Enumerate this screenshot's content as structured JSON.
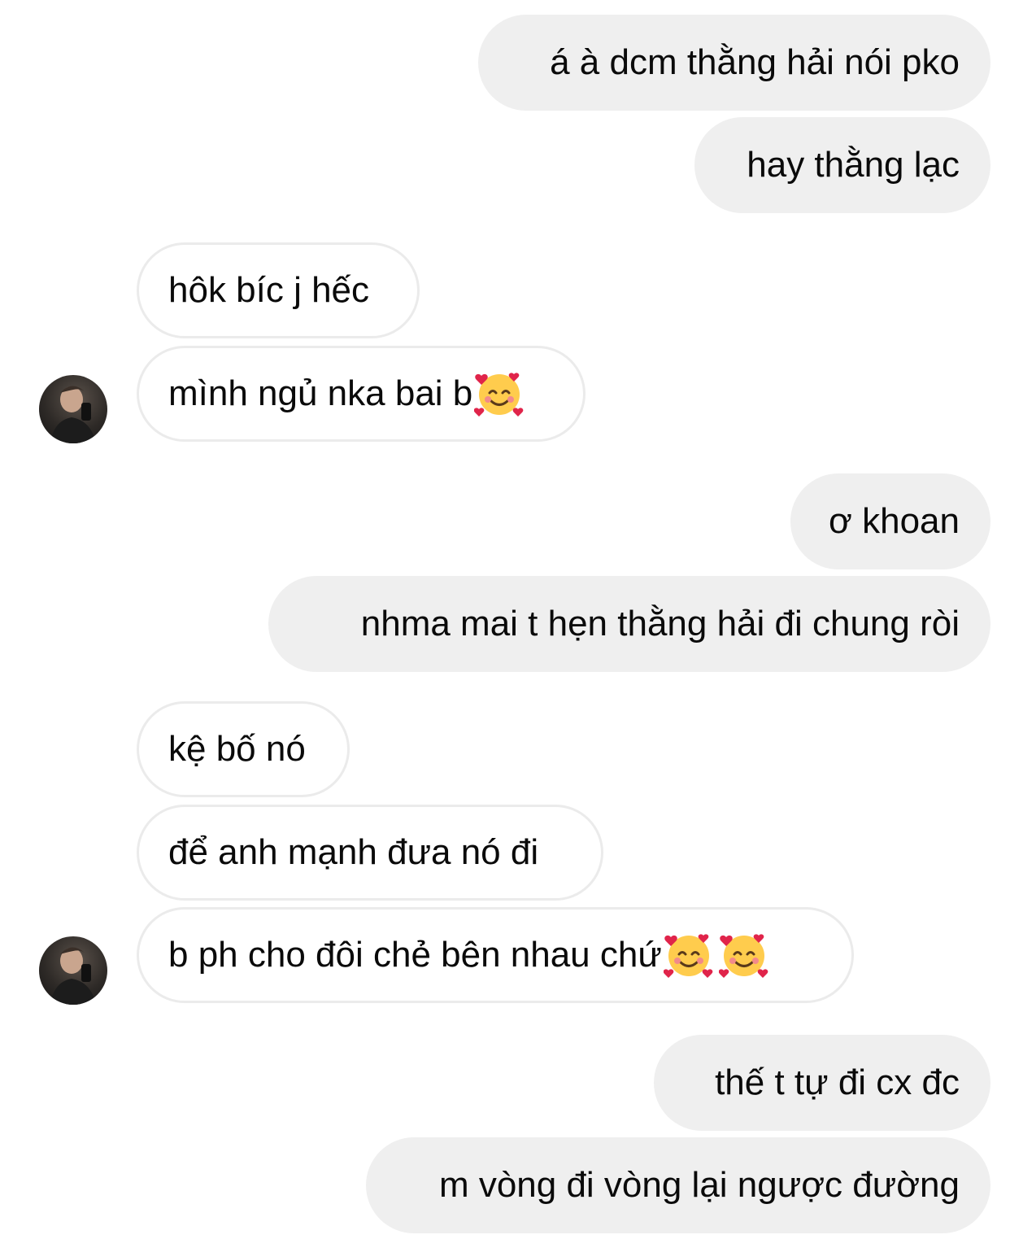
{
  "messages": [
    {
      "side": "out",
      "text": "á à dcm thằng hải nói pko"
    },
    {
      "side": "out",
      "text": "hay thằng lạc"
    },
    {
      "side": "in",
      "text": "hôk bíc j hếc"
    },
    {
      "side": "in",
      "text": "mình ngủ nka bai b",
      "emoji": "smiling-face-with-hearts"
    },
    {
      "side": "out",
      "text": "ơ khoan"
    },
    {
      "side": "out",
      "text": "nhma mai t hẹn thằng hải đi chung ròi"
    },
    {
      "side": "in",
      "text": "kệ bố nó"
    },
    {
      "side": "in",
      "text": "để anh mạnh đưa nó đi"
    },
    {
      "side": "in",
      "text": "b ph cho đôi chẻ bên nhau chứ",
      "emoji": "smiling-face-with-hearts x2"
    },
    {
      "side": "out",
      "text": "thế t tự đi cx đc"
    },
    {
      "side": "out",
      "text": "m vòng đi vòng lại ngược đường"
    }
  ],
  "colors": {
    "outgoing_bubble": "#efefef",
    "incoming_border": "#ebebeb",
    "background": "#ffffff"
  }
}
